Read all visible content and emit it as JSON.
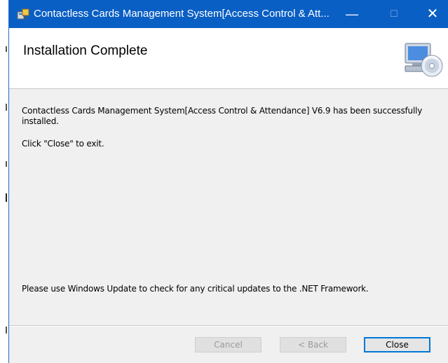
{
  "window": {
    "title": "Contactless Cards Management System[Access Control & Att...",
    "controls": {
      "minimize": "—",
      "maximize": "☐",
      "close": "✕"
    }
  },
  "header": {
    "title": "Installation Complete",
    "icon": "computer-cd-icon"
  },
  "body": {
    "message": "Contactless Cards Management System[Access Control & Attendance] V6.9 has been successfully installed.",
    "instruction": "Click \"Close\" to exit.",
    "update_notice": "Please use Windows Update to check for any critical updates to the .NET Framework."
  },
  "buttons": {
    "cancel": "Cancel",
    "back": "< Back",
    "close": "Close"
  },
  "colors": {
    "titlebar": "#0a5fc4",
    "focus_border": "#0078d7"
  }
}
